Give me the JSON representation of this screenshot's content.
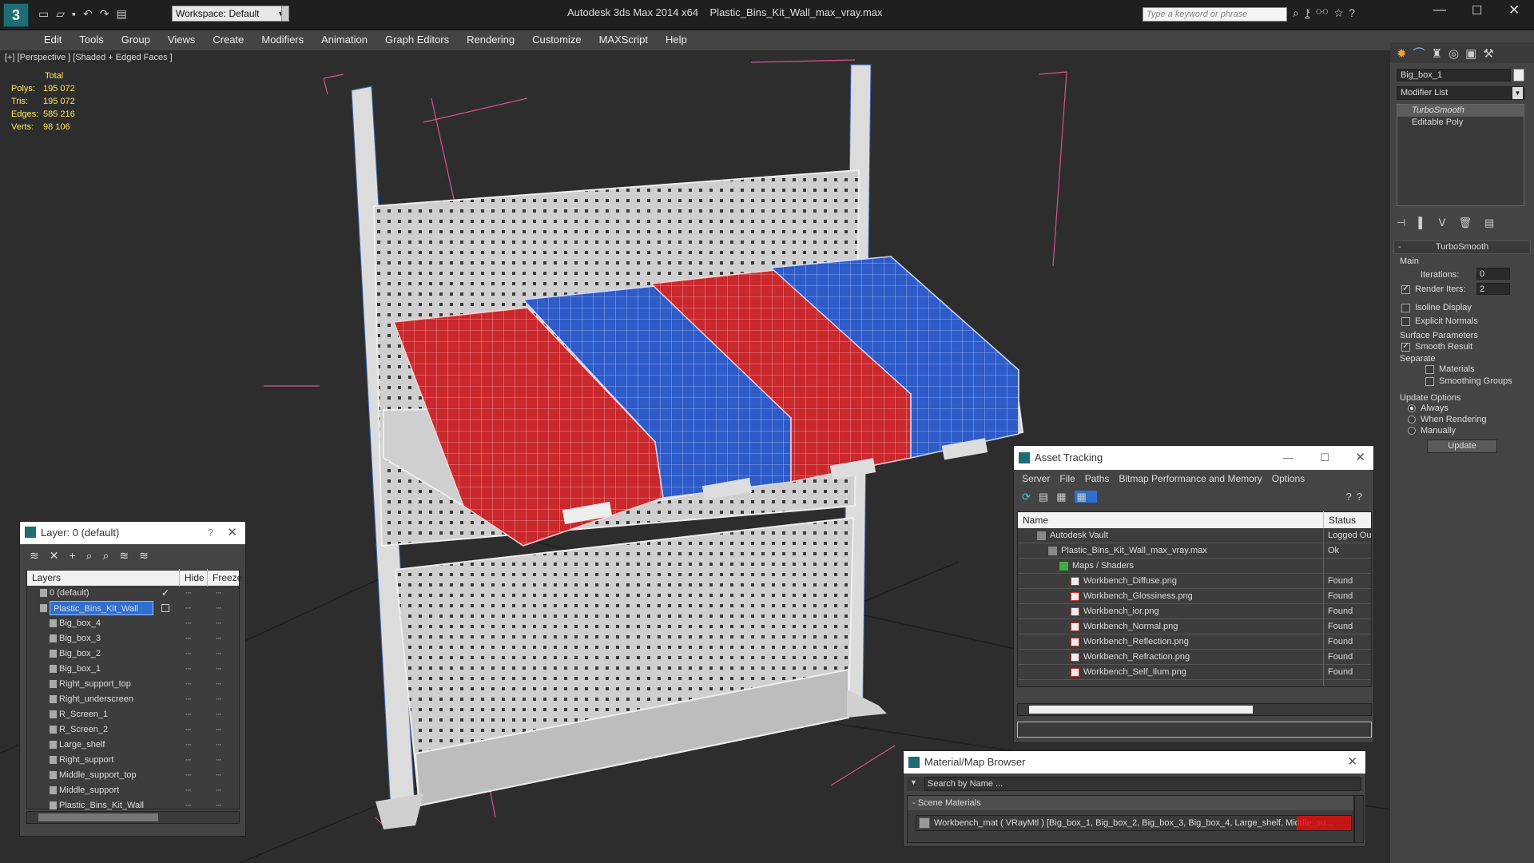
{
  "app": {
    "title": "Autodesk 3ds Max  2014 x64",
    "filename": "Plastic_Bins_Kit_Wall_max_vray.max",
    "workspace": "Workspace: Default",
    "search_placeholder": "Type a keyword or phrase"
  },
  "menu": [
    "Edit",
    "Tools",
    "Group",
    "Views",
    "Create",
    "Modifiers",
    "Animation",
    "Graph Editors",
    "Rendering",
    "Customize",
    "MAXScript",
    "Help"
  ],
  "viewport": {
    "label": "[+] [Perspective ] [Shaded + Edged Faces ]",
    "stats": {
      "header": "Total",
      "rows": [
        {
          "k": "Polys:",
          "v": "195 072"
        },
        {
          "k": "Tris:",
          "v": "195 072"
        },
        {
          "k": "Edges:",
          "v": "585 216"
        },
        {
          "k": "Verts:",
          "v": "98 106"
        }
      ]
    }
  },
  "cmd": {
    "object_name": "Big_box_1",
    "modifier_list": "Modifier List",
    "stack": [
      "TurboSmooth",
      "Editable Poly"
    ],
    "rollout": "TurboSmooth",
    "main": "Main",
    "iterations_label": "Iterations:",
    "iterations": "0",
    "render_iters_label": "Render Iters:",
    "render_iters": "2",
    "isoline": "Isoline Display",
    "explicit": "Explicit Normals",
    "surface": "Surface Parameters",
    "smooth_result": "Smooth Result",
    "separate": "Separate",
    "materials": "Materials",
    "smoothing_groups": "Smoothing Groups",
    "update_options": "Update Options",
    "always": "Always",
    "when_rendering": "When Rendering",
    "manually": "Manually",
    "update_btn": "Update"
  },
  "layer": {
    "title": "Layer: 0 (default)",
    "help": "?",
    "cols": {
      "layers": "Layers",
      "hide": "Hide",
      "freeze": "Freeze"
    },
    "rows": [
      "0 (default)",
      "Plastic_Bins_Kit_Wall",
      "Big_box_4",
      "Big_box_3",
      "Big_box_2",
      "Big_box_1",
      "Right_support_top",
      "Right_underscreen",
      "R_Screen_1",
      "R_Screen_2",
      "Large_shelf",
      "Right_support",
      "Middle_support_top",
      "Middle_support",
      "Plastic_Bins_Kit_Wall"
    ]
  },
  "asset": {
    "title": "Asset Tracking",
    "menu": [
      "Server",
      "File",
      "Paths",
      "Bitmap Performance and Memory",
      "Options"
    ],
    "cols": {
      "name": "Name",
      "status": "Status"
    },
    "rows": [
      {
        "name": "Autodesk Vault",
        "status": "Logged Ou",
        "indent": 0
      },
      {
        "name": "Plastic_Bins_Kit_Wall_max_vray.max",
        "status": "Ok",
        "indent": 1
      },
      {
        "name": "Maps / Shaders",
        "status": "",
        "indent": 2
      },
      {
        "name": "Workbench_Diffuse.png",
        "status": "Found",
        "indent": 3
      },
      {
        "name": "Workbench_Glossiness.png",
        "status": "Found",
        "indent": 3
      },
      {
        "name": "Workbench_ior.png",
        "status": "Found",
        "indent": 3
      },
      {
        "name": "Workbench_Normal.png",
        "status": "Found",
        "indent": 3
      },
      {
        "name": "Workbench_Reflection.png",
        "status": "Found",
        "indent": 3
      },
      {
        "name": "Workbench_Refraction.png",
        "status": "Found",
        "indent": 3
      },
      {
        "name": "Workbench_Self_Ilum.png",
        "status": "Found",
        "indent": 3
      }
    ]
  },
  "matbrowser": {
    "title": "Material/Map Browser",
    "search": "Search by Name ...",
    "section": "- Scene Materials",
    "material": "Workbench_mat ( VRayMtl ) [Big_box_1, Big_box_2, Big_box_3, Big_box_4, Large_shelf, Middle_su..."
  }
}
